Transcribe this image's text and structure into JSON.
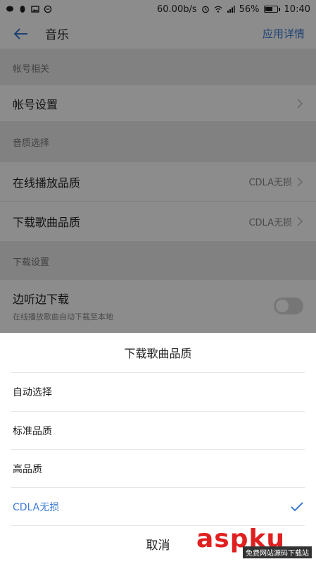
{
  "status_bar": {
    "network_speed": "60.00b/s",
    "battery": "56%",
    "time": "10:40"
  },
  "header": {
    "title": "音乐",
    "app_detail": "应用详情"
  },
  "sections": {
    "account": {
      "header": "帐号相关",
      "account_settings": "帐号设置"
    },
    "quality": {
      "header": "音质选择",
      "online_label": "在线播放品质",
      "online_value": "CDLA无损",
      "download_label": "下载歌曲品质",
      "download_value": "CDLA无损"
    },
    "download": {
      "header": "下载设置",
      "listen_download_label": "边听边下载",
      "listen_download_desc": "在线播放歌曲自动下载至本地",
      "listen_download_on": false
    }
  },
  "sheet": {
    "title": "下载歌曲品质",
    "options": [
      "自动选择",
      "标准品质",
      "高品质",
      "CDLA无损"
    ],
    "selected_index": 3,
    "cancel": "取消"
  },
  "watermark": {
    "main": "aspku",
    "sub": "免费网站源码下载站"
  },
  "colors": {
    "accent": "#3b7bd6",
    "watermark": "#e02020"
  }
}
